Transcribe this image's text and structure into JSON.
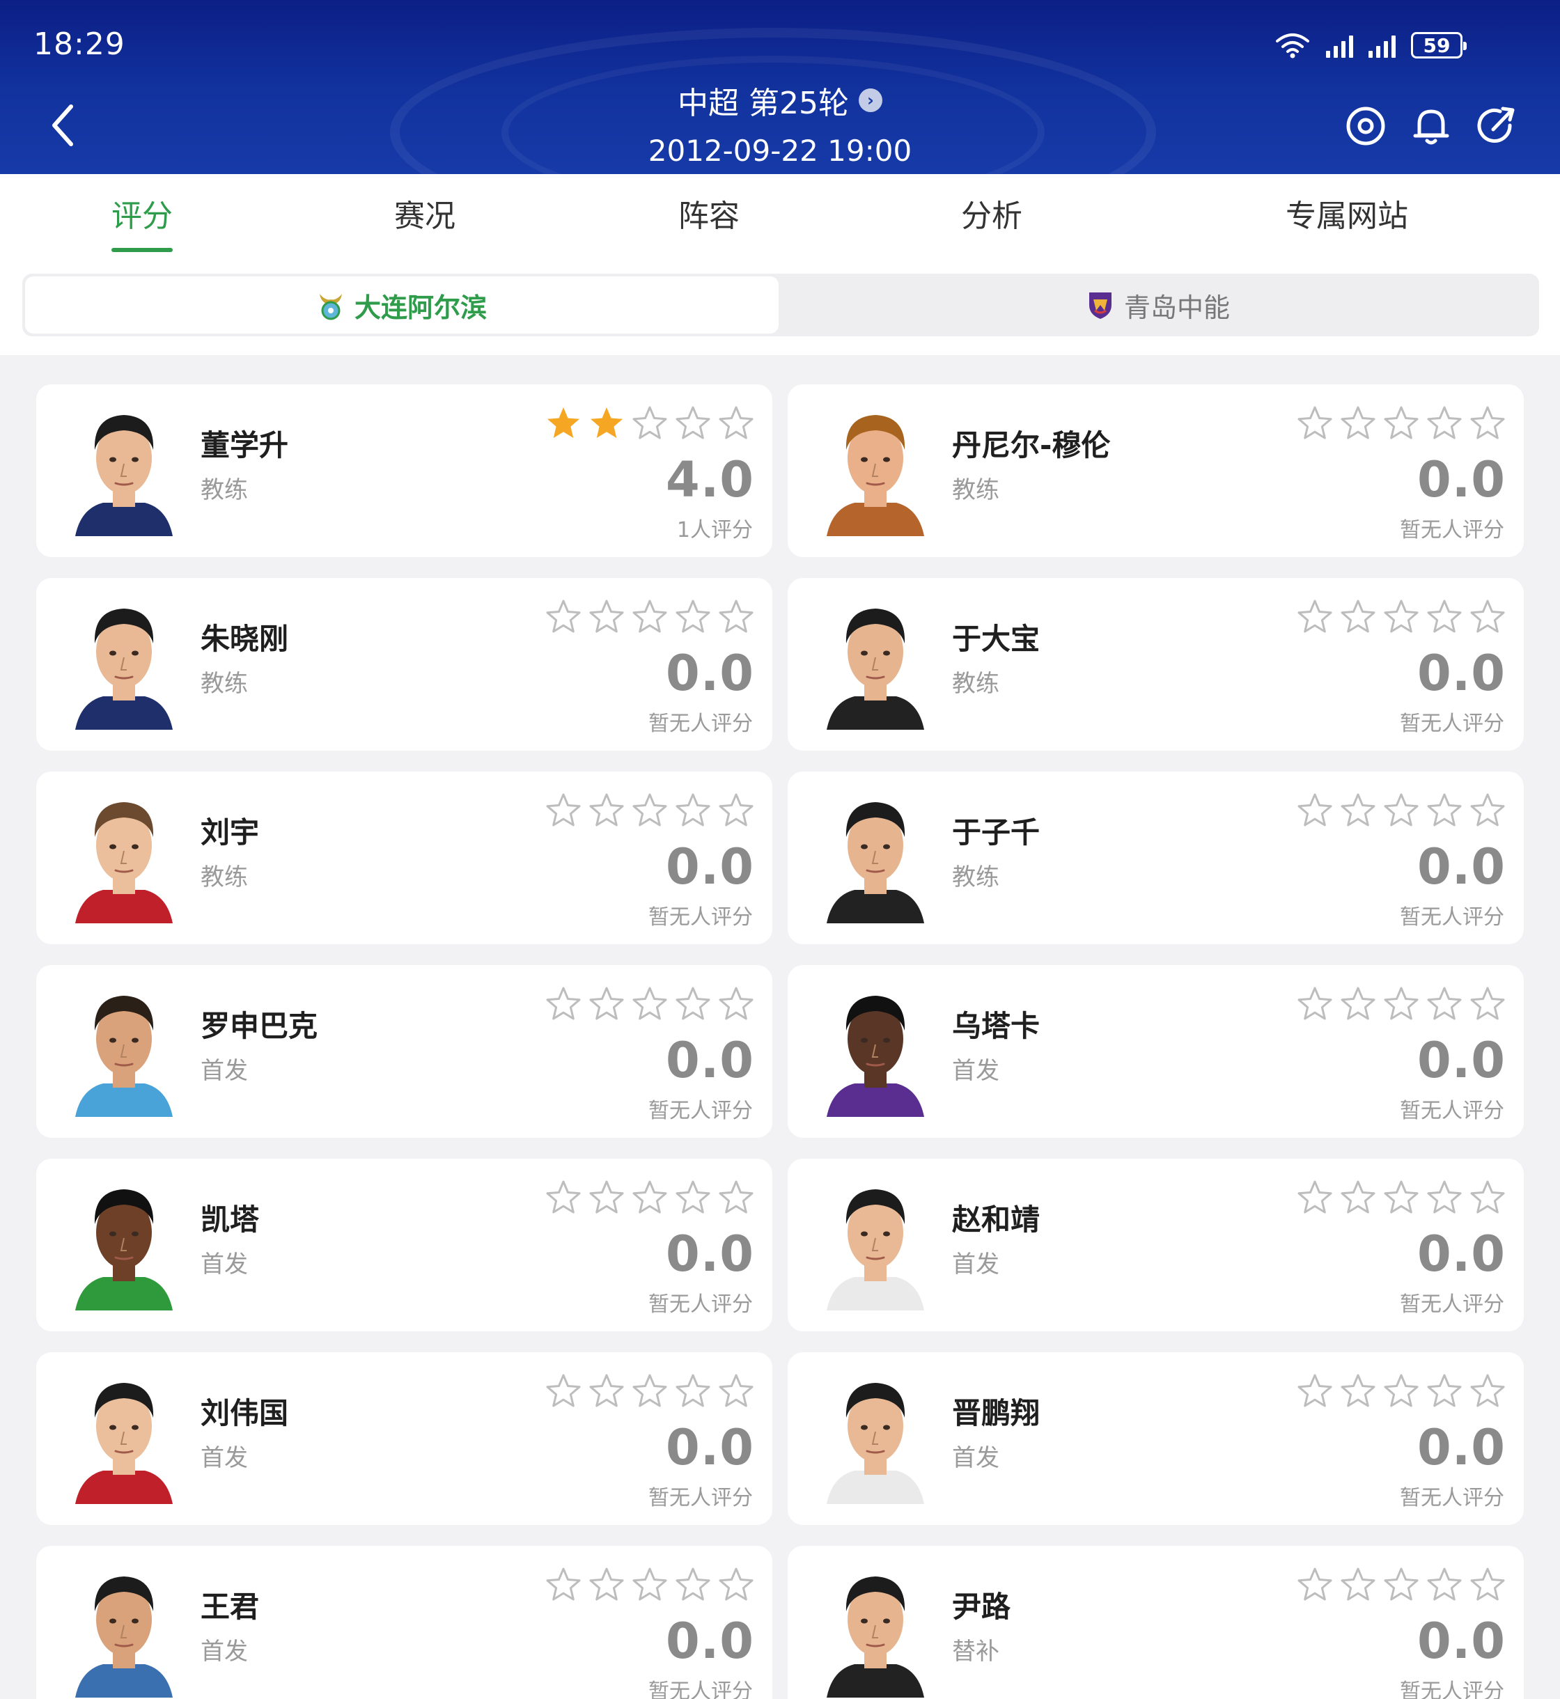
{
  "status_bar": {
    "time": "18:29",
    "battery": "59"
  },
  "header": {
    "title": "中超 第25轮",
    "datetime": "2012-09-22 19:00"
  },
  "tabs": [
    {
      "label": "评分",
      "active": true
    },
    {
      "label": "赛况",
      "active": false
    },
    {
      "label": "阵容",
      "active": false
    },
    {
      "label": "分析",
      "active": false
    },
    {
      "label": "专属网站",
      "active": false
    }
  ],
  "teams": {
    "home": "大连阿尔滨",
    "away": "青岛中能"
  },
  "colors": {
    "accent": "#2e9c4a",
    "header": "#12339f",
    "star_filled": "#f5a623",
    "star_empty": "#bdbdbd"
  },
  "players": [
    {
      "name": "董学升",
      "role": "教练",
      "score": "4.0",
      "raters": "1人评分",
      "stars_filled": 2
    },
    {
      "name": "丹尼尔-穆伦",
      "role": "教练",
      "score": "0.0",
      "raters": "暂无人评分",
      "stars_filled": 0
    },
    {
      "name": "朱晓刚",
      "role": "教练",
      "score": "0.0",
      "raters": "暂无人评分",
      "stars_filled": 0
    },
    {
      "name": "于大宝",
      "role": "教练",
      "score": "0.0",
      "raters": "暂无人评分",
      "stars_filled": 0
    },
    {
      "name": "刘宇",
      "role": "教练",
      "score": "0.0",
      "raters": "暂无人评分",
      "stars_filled": 0
    },
    {
      "name": "于子千",
      "role": "教练",
      "score": "0.0",
      "raters": "暂无人评分",
      "stars_filled": 0
    },
    {
      "name": "罗申巴克",
      "role": "首发",
      "score": "0.0",
      "raters": "暂无人评分",
      "stars_filled": 0
    },
    {
      "name": "乌塔卡",
      "role": "首发",
      "score": "0.0",
      "raters": "暂无人评分",
      "stars_filled": 0
    },
    {
      "name": "凯塔",
      "role": "首发",
      "score": "0.0",
      "raters": "暂无人评分",
      "stars_filled": 0
    },
    {
      "name": "赵和靖",
      "role": "首发",
      "score": "0.0",
      "raters": "暂无人评分",
      "stars_filled": 0
    },
    {
      "name": "刘伟国",
      "role": "首发",
      "score": "0.0",
      "raters": "暂无人评分",
      "stars_filled": 0
    },
    {
      "name": "晋鹏翔",
      "role": "首发",
      "score": "0.0",
      "raters": "暂无人评分",
      "stars_filled": 0
    },
    {
      "name": "王君",
      "role": "首发",
      "score": "0.0",
      "raters": "暂无人评分",
      "stars_filled": 0
    },
    {
      "name": "尹路",
      "role": "替补",
      "score": "0.0",
      "raters": "暂无人评分",
      "stars_filled": 0
    }
  ]
}
